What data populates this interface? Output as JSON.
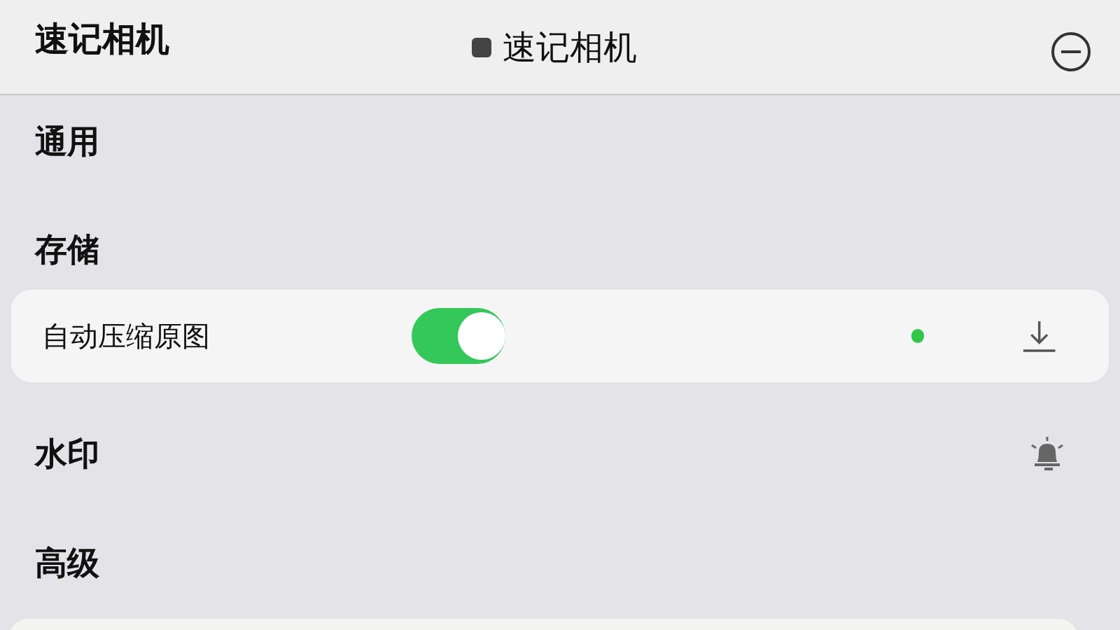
{
  "header": {
    "title": "速记相机",
    "center_title": "速记相机"
  },
  "items": [
    {
      "kind": "section",
      "label": "通用"
    },
    {
      "kind": "section",
      "label": "存储"
    },
    {
      "kind": "toggle",
      "label": "自动压缩原图",
      "on": true
    },
    {
      "kind": "section",
      "label": "水印"
    },
    {
      "kind": "section",
      "label": "高级"
    }
  ]
}
